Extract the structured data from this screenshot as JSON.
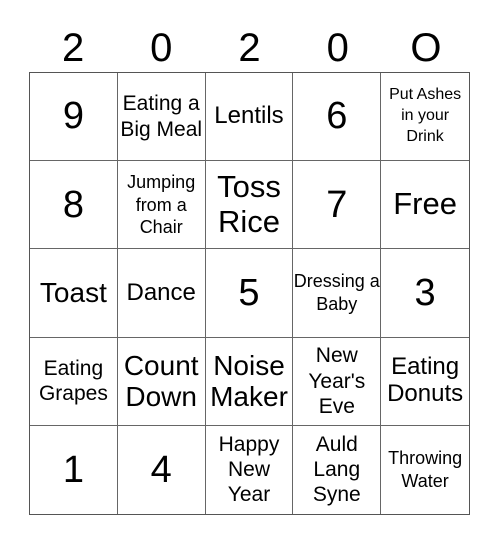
{
  "header": [
    "2",
    "0",
    "2",
    "0",
    "O"
  ],
  "cells": [
    {
      "text": "9",
      "size": "s40"
    },
    {
      "text": "Eating a Big Meal",
      "size": "s21"
    },
    {
      "text": "Lentils",
      "size": "s24"
    },
    {
      "text": "6",
      "size": "s40"
    },
    {
      "text": "Put Ashes in your Drink",
      "size": "s16"
    },
    {
      "text": "8",
      "size": "s40"
    },
    {
      "text": "Jumping from a Chair",
      "size": "s18"
    },
    {
      "text": "Toss Rice",
      "size": "s32"
    },
    {
      "text": "7",
      "size": "s40"
    },
    {
      "text": "Free",
      "size": "s32"
    },
    {
      "text": "Toast",
      "size": "s28"
    },
    {
      "text": "Dance",
      "size": "s24"
    },
    {
      "text": "5",
      "size": "s40"
    },
    {
      "text": "Dressing a Baby",
      "size": "s18"
    },
    {
      "text": "3",
      "size": "s40"
    },
    {
      "text": "Eating Grapes",
      "size": "s21"
    },
    {
      "text": "Count Down",
      "size": "s28"
    },
    {
      "text": "Noise Maker",
      "size": "s28"
    },
    {
      "text": "New Year's Eve",
      "size": "s21"
    },
    {
      "text": "Eating Donuts",
      "size": "s24"
    },
    {
      "text": "1",
      "size": "s40"
    },
    {
      "text": "4",
      "size": "s40"
    },
    {
      "text": "Happy New Year",
      "size": "s21"
    },
    {
      "text": "Auld Lang Syne",
      "size": "s21"
    },
    {
      "text": "Throwing Water",
      "size": "s18"
    }
  ]
}
